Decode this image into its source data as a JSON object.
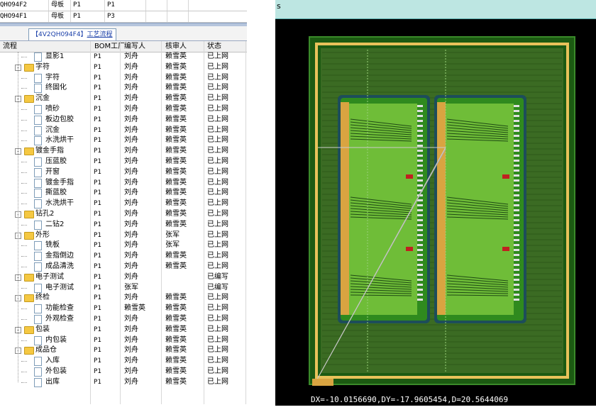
{
  "top_rows": [
    {
      "code": "QHO94F2",
      "type": "母板",
      "plant": "P1",
      "seq": "P1"
    },
    {
      "code": "QHO94F1",
      "type": "母板",
      "plant": "P1",
      "seq": "P3"
    }
  ],
  "tab": {
    "code": "【4V2QH094F4】",
    "title": "工艺流程"
  },
  "columns": {
    "process": "流程",
    "bom": "BOM工厂",
    "writer": "编写人",
    "reviewer": "核审人",
    "status": "状态"
  },
  "rows": [
    {
      "level": 2,
      "kind": "doc",
      "name": "显影1",
      "bom": "P1",
      "writer": "刘舟",
      "reviewer": "赖雪英",
      "status": "已上网"
    },
    {
      "level": 1,
      "kind": "folder",
      "name": "字符",
      "bom": "P1",
      "writer": "刘舟",
      "reviewer": "赖雪英",
      "status": "已上网"
    },
    {
      "level": 2,
      "kind": "doc",
      "name": "字符",
      "bom": "P1",
      "writer": "刘舟",
      "reviewer": "赖雪英",
      "status": "已上网"
    },
    {
      "level": 2,
      "kind": "doc",
      "name": "终固化",
      "bom": "P1",
      "writer": "刘舟",
      "reviewer": "赖雪英",
      "status": "已上网"
    },
    {
      "level": 1,
      "kind": "folder",
      "name": "沉金",
      "bom": "P1",
      "writer": "刘舟",
      "reviewer": "赖雪英",
      "status": "已上网"
    },
    {
      "level": 2,
      "kind": "doc",
      "name": "喷砂",
      "bom": "P1",
      "writer": "刘舟",
      "reviewer": "赖雪英",
      "status": "已上网"
    },
    {
      "level": 2,
      "kind": "doc",
      "name": "板边包胶",
      "bom": "P1",
      "writer": "刘舟",
      "reviewer": "赖雪英",
      "status": "已上网"
    },
    {
      "level": 2,
      "kind": "doc",
      "name": "沉金",
      "bom": "P1",
      "writer": "刘舟",
      "reviewer": "赖雪英",
      "status": "已上网"
    },
    {
      "level": 2,
      "kind": "doc",
      "name": "水洗烘干",
      "bom": "P1",
      "writer": "刘舟",
      "reviewer": "赖雪英",
      "status": "已上网"
    },
    {
      "level": 1,
      "kind": "folder",
      "name": "镀金手指",
      "bom": "P1",
      "writer": "刘舟",
      "reviewer": "赖雪英",
      "status": "已上网"
    },
    {
      "level": 2,
      "kind": "doc",
      "name": "压蓝胶",
      "bom": "P1",
      "writer": "刘舟",
      "reviewer": "赖雪英",
      "status": "已上网"
    },
    {
      "level": 2,
      "kind": "doc",
      "name": "开窗",
      "bom": "P1",
      "writer": "刘舟",
      "reviewer": "赖雪英",
      "status": "已上网"
    },
    {
      "level": 2,
      "kind": "doc",
      "name": "镀金手指",
      "bom": "P1",
      "writer": "刘舟",
      "reviewer": "赖雪英",
      "status": "已上网"
    },
    {
      "level": 2,
      "kind": "doc",
      "name": "撕蓝胶",
      "bom": "P1",
      "writer": "刘舟",
      "reviewer": "赖雪英",
      "status": "已上网"
    },
    {
      "level": 2,
      "kind": "doc",
      "name": "水洗烘干",
      "bom": "P1",
      "writer": "刘舟",
      "reviewer": "赖雪英",
      "status": "已上网"
    },
    {
      "level": 1,
      "kind": "folder",
      "name": "钻孔2",
      "bom": "P1",
      "writer": "刘舟",
      "reviewer": "赖雪英",
      "status": "已上网"
    },
    {
      "level": 2,
      "kind": "doc",
      "name": "二钻2",
      "bom": "P1",
      "writer": "刘舟",
      "reviewer": "赖雪英",
      "status": "已上网"
    },
    {
      "level": 1,
      "kind": "folder",
      "name": "外形",
      "bom": "P1",
      "writer": "刘舟",
      "reviewer": "张军",
      "status": "已上网"
    },
    {
      "level": 2,
      "kind": "doc",
      "name": "铣板",
      "bom": "P1",
      "writer": "刘舟",
      "reviewer": "张军",
      "status": "已上网"
    },
    {
      "level": 2,
      "kind": "doc",
      "name": "金指倒边",
      "bom": "P1",
      "writer": "刘舟",
      "reviewer": "赖雪英",
      "status": "已上网"
    },
    {
      "level": 2,
      "kind": "doc",
      "name": "成品清洗",
      "bom": "P1",
      "writer": "刘舟",
      "reviewer": "赖雪英",
      "status": "已上网"
    },
    {
      "level": 1,
      "kind": "folder",
      "name": "电子测试",
      "bom": "P1",
      "writer": "刘舟",
      "reviewer": "",
      "status": "已编写"
    },
    {
      "level": 2,
      "kind": "doc",
      "name": "电子测试",
      "bom": "P1",
      "writer": "张军",
      "reviewer": "",
      "status": "已编写"
    },
    {
      "level": 1,
      "kind": "folder",
      "name": "终检",
      "bom": "P1",
      "writer": "刘舟",
      "reviewer": "赖雪英",
      "status": "已上网"
    },
    {
      "level": 2,
      "kind": "doc",
      "name": "功能检查",
      "bom": "P1",
      "writer": "赖雪英",
      "reviewer": "赖雪英",
      "status": "已上网"
    },
    {
      "level": 2,
      "kind": "doc",
      "name": "外观检查",
      "bom": "P1",
      "writer": "刘舟",
      "reviewer": "赖雪英",
      "status": "已上网"
    },
    {
      "level": 1,
      "kind": "folder",
      "name": "包装",
      "bom": "P1",
      "writer": "刘舟",
      "reviewer": "赖雪英",
      "status": "已上网"
    },
    {
      "level": 2,
      "kind": "doc",
      "name": "内包装",
      "bom": "P1",
      "writer": "刘舟",
      "reviewer": "赖雪英",
      "status": "已上网"
    },
    {
      "level": 1,
      "kind": "folder",
      "name": "成品仓",
      "bom": "P1",
      "writer": "刘舟",
      "reviewer": "赖雪英",
      "status": "已上网"
    },
    {
      "level": 2,
      "kind": "doc",
      "name": "入库",
      "bom": "P1",
      "writer": "刘舟",
      "reviewer": "赖雪英",
      "status": "已上网"
    },
    {
      "level": 2,
      "kind": "doc",
      "name": "外包装",
      "bom": "P1",
      "writer": "刘舟",
      "reviewer": "赖雪英",
      "status": "已上网"
    },
    {
      "level": 2,
      "kind": "doc",
      "name": "出库",
      "bom": "P1",
      "writer": "刘舟",
      "reviewer": "赖雪英",
      "status": "已上网"
    }
  ],
  "cam": {
    "title": "s",
    "coords": "DX=-10.0156690,DY=-17.9605454,D=20.5644069",
    "colors": {
      "background": "#000000",
      "board": "#2f8a1e",
      "copper": "#6fbd38",
      "pads": "#d9a441",
      "outline": "#e8c25a"
    }
  }
}
